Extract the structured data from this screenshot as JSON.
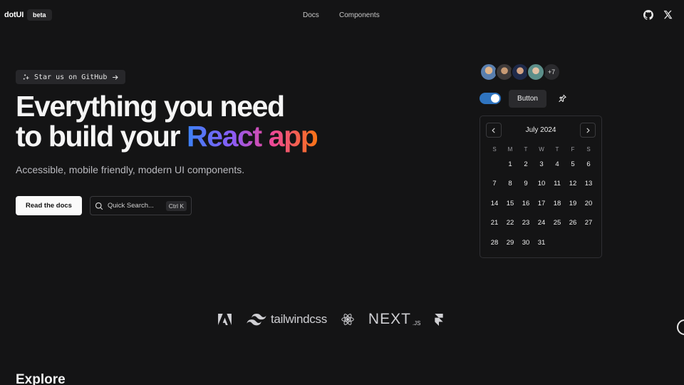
{
  "header": {
    "logo": "dotUI",
    "badge": "beta",
    "nav": [
      "Docs",
      "Components"
    ],
    "icons": [
      "github-icon",
      "x-icon"
    ]
  },
  "hero": {
    "star_pill": "Star us on GitHub",
    "title_line1": "Everything you need",
    "title_line2_plain": "to build your",
    "title_line2_gradient": "React app",
    "subtitle": "Accessible, mobile friendly, modern UI components.",
    "cta_primary": "Read the docs",
    "search_placeholder": "Quick Search...",
    "search_shortcut": "Ctrl K"
  },
  "demo": {
    "avatars_more": "+7",
    "toggle_on": true,
    "button_label": "Button",
    "calendar": {
      "month": "July 2024",
      "weekdays": [
        "S",
        "M",
        "T",
        "W",
        "T",
        "F",
        "S"
      ],
      "leading_blanks": 1,
      "days": [
        "1",
        "2",
        "3",
        "4",
        "5",
        "6",
        "7",
        "8",
        "9",
        "10",
        "11",
        "12",
        "13",
        "14",
        "15",
        "16",
        "17",
        "18",
        "19",
        "20",
        "21",
        "22",
        "23",
        "24",
        "25",
        "26",
        "27",
        "28",
        "29",
        "30",
        "31"
      ]
    }
  },
  "logos": {
    "tailwind": "tailwindcss",
    "next": "NEXT",
    "next_sub": ".JS"
  },
  "explore": "Explore",
  "colors": {
    "background": "#141415",
    "toggle": "#2f74c0",
    "gradient": [
      "#3b82f6",
      "#8b5cf6",
      "#ec4899",
      "#f97316"
    ]
  }
}
